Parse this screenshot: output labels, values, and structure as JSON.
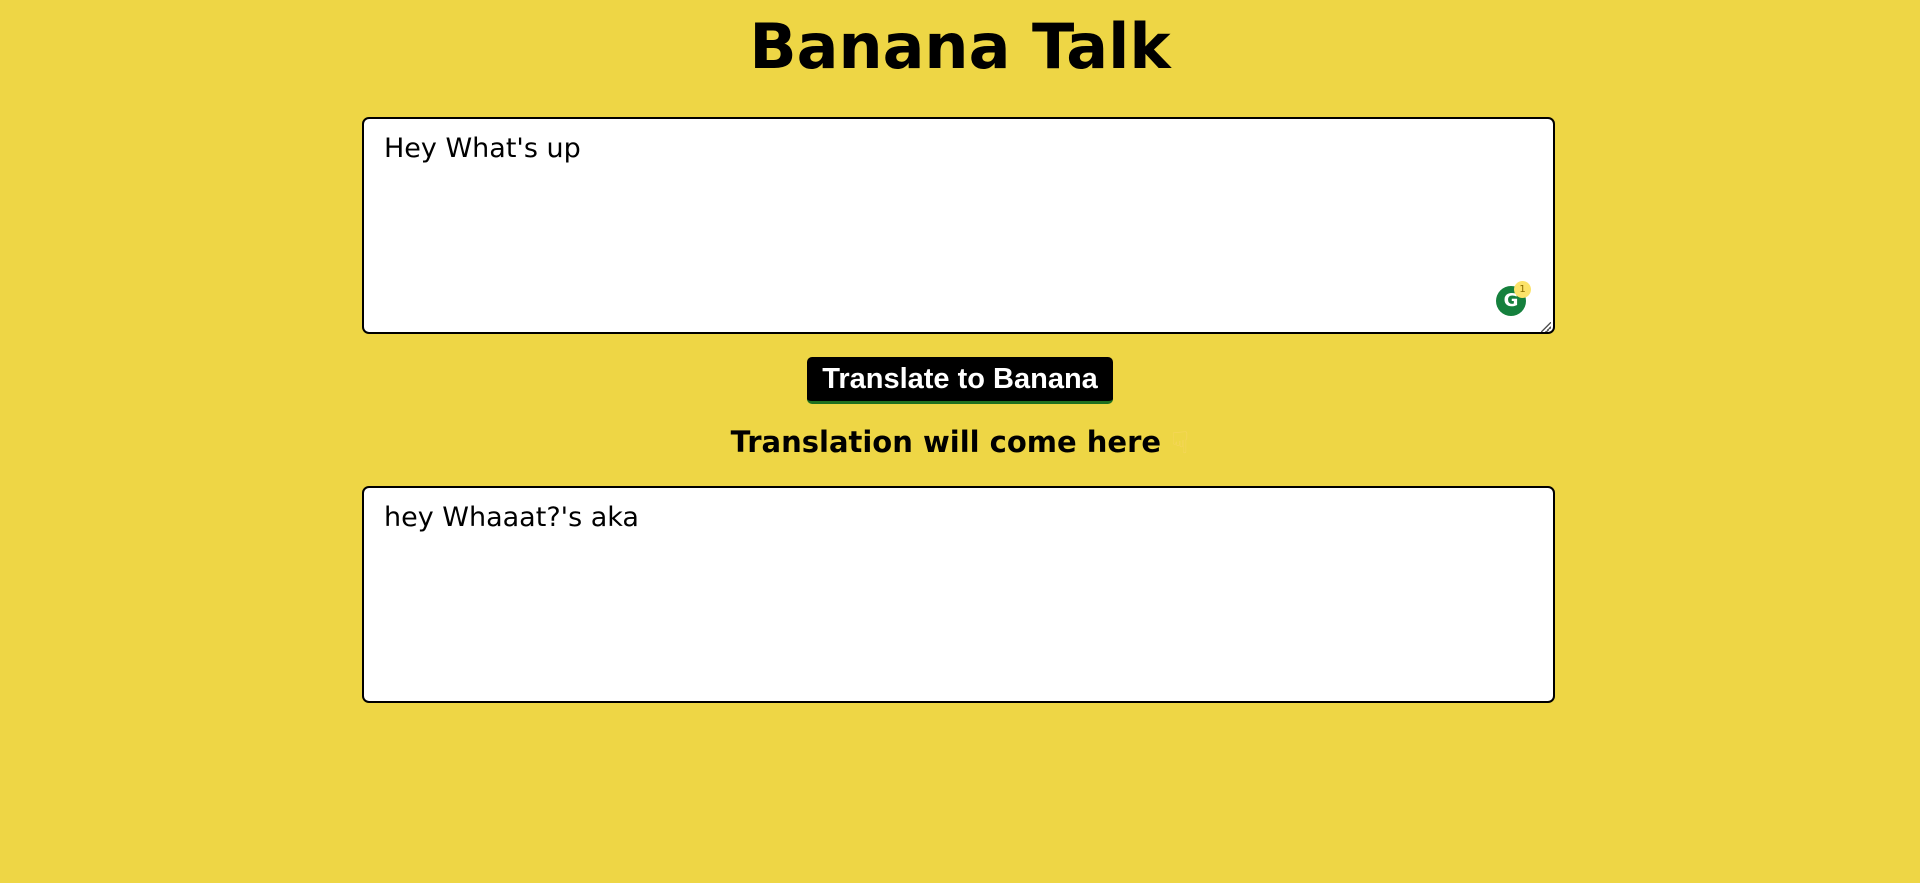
{
  "header": {
    "title": "Banana Talk"
  },
  "input": {
    "value": "Hey What's up",
    "grammarly_badge_count": "1",
    "grammarly_icon": "grammarly-icon"
  },
  "actions": {
    "translate_label": "Translate to Banana"
  },
  "output_section": {
    "heading": "Translation will come here",
    "pointer_icon": "pointing-down-hand-icon",
    "value": "hey Whaaat?'s aka"
  },
  "colors": {
    "background": "#EED645",
    "button_bg": "#000000",
    "button_text": "#FFFFFF",
    "grammarly": "#15803D"
  }
}
